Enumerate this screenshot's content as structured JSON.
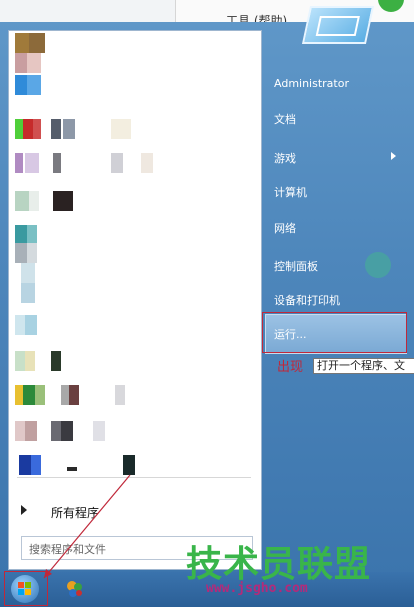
{
  "background": {
    "window_text": "工具 (帮助)"
  },
  "start_menu": {
    "right_pane": [
      {
        "label": "Administrator",
        "has_arrow": false
      },
      {
        "label": "文档",
        "has_arrow": false
      },
      {
        "label": "游戏",
        "has_arrow": true
      },
      {
        "label": "计算机",
        "has_arrow": false
      },
      {
        "label": "网络",
        "has_arrow": false
      },
      {
        "label": "控制面板",
        "has_arrow": false
      },
      {
        "label": "设备和打印机",
        "has_arrow": false
      },
      {
        "label": "运行...",
        "has_arrow": false
      }
    ],
    "all_programs_label": "所有程序",
    "search_placeholder": "搜索程序和文件"
  },
  "annotation": {
    "callout_text": "出现",
    "tooltip_text": "打开一个程序、文"
  },
  "watermark": {
    "title": "技术员联盟",
    "url": "www.jsgho.com"
  },
  "colors": {
    "menu_blue": "#4d86bb",
    "highlight": "#c0283a",
    "watermark_green": "#39b54a",
    "watermark_pink": "#b42a7a"
  }
}
